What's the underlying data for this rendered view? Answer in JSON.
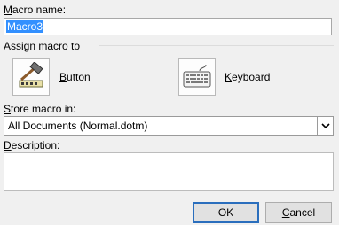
{
  "macro_name": {
    "label_key": "M",
    "label_rest": "acro name:",
    "value": "Macro3"
  },
  "assign": {
    "title": "Assign macro to",
    "button": {
      "label_key": "B",
      "label_rest": "utton",
      "icon": "hammer-icon"
    },
    "keyboard": {
      "label_key": "K",
      "label_rest": "eyboard",
      "icon": "keyboard-icon"
    }
  },
  "store": {
    "label_key": "S",
    "label_rest": "tore macro in:",
    "value": "All Documents (Normal.dotm)"
  },
  "description": {
    "label_key": "D",
    "label_rest": "escription:",
    "value": ""
  },
  "buttons": {
    "ok": "OK",
    "cancel_key": "C",
    "cancel_rest": "ancel"
  }
}
